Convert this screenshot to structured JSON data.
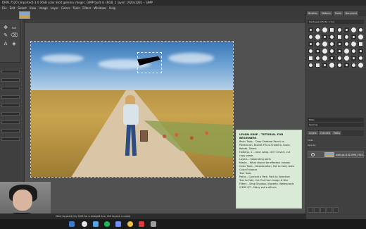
{
  "window": {
    "title": "DRW_7520 (imported)-3.0 (RGB color 8-bit gamma integer, GIMP built-in sRGB, 1 layer) 1920x1281 – GIMP"
  },
  "menu": [
    "File",
    "Edit",
    "Select",
    "View",
    "Image",
    "Layer",
    "Colors",
    "Tools",
    "Filters",
    "Windows",
    "Help"
  ],
  "dock": {
    "top_tabs": [
      "Brushes",
      "Patterns",
      "Fonts",
      "Document"
    ],
    "brush_name": "Hardness 075 (51 × 51)",
    "tag_filter": "Basic",
    "spacing": "Spacing",
    "layers_tabs": [
      "Layers",
      "Channels",
      "Paths"
    ],
    "mode_label": "Mode",
    "opacity_label": "Opacity",
    "layer_name": "walk-girl-1613996_1920..."
  },
  "overlay": {
    "title": "LEARN GIMP – TUTORIAL FOR BEGINNERS",
    "lines": [
      "Basic Tools – Drop Shadow/ Pencil vs",
      "Paintbrush, Bucket Fill vs Gradient, Scale,",
      "Rotate, Select",
      "Hotkeys, x – color swap, ctrl+i invert, cut",
      "copy paste,",
      "Layers – Separating parts",
      "Masks – What should be effected / shown",
      "Color Tools – Desaturation, Hot to Cold, Auto",
      "Color Enhance",
      "Text Tools",
      "Paths – Connect a Path, Path to Selection",
      "Text to Path, Cut Out from Image & Blur",
      "Filters – Drop Shadow, Vignette, Waterpixels",
      "G'MIC QT – Many extra effects"
    ]
  },
  "status": {
    "hint": "Click to paint (try Shift for a straight line, Ctrl to pick a color)"
  },
  "icons": {
    "move": "move-icon",
    "text": "text-tool-icon",
    "paintbrush": "paintbrush-icon",
    "eraser": "eraser-icon",
    "eye": "eye-icon"
  }
}
